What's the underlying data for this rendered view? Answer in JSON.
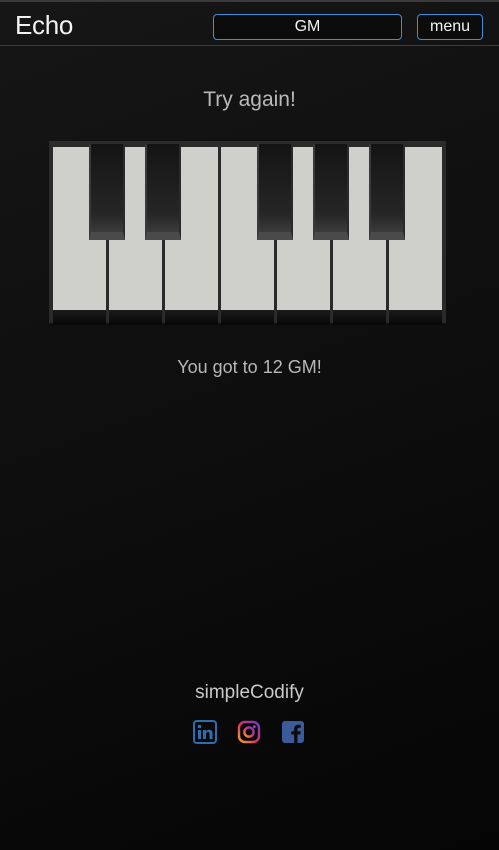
{
  "header": {
    "app_title": "Echo",
    "mode_select_value": "GM",
    "menu_label": "menu"
  },
  "game": {
    "status": "Try again!",
    "score_text": "You got to 12 GM!"
  },
  "piano": {
    "white_key_count": 7,
    "black_key_count": 5
  },
  "footer": {
    "brand": "simpleCodify",
    "social_icons": [
      "linkedin-icon",
      "instagram-icon",
      "facebook-icon"
    ]
  },
  "colors": {
    "accent_border": "#3f8fd8",
    "white_key": "#cfd0cb",
    "linkedin": "#2a6fb1",
    "facebook": "#3b5b9a"
  }
}
